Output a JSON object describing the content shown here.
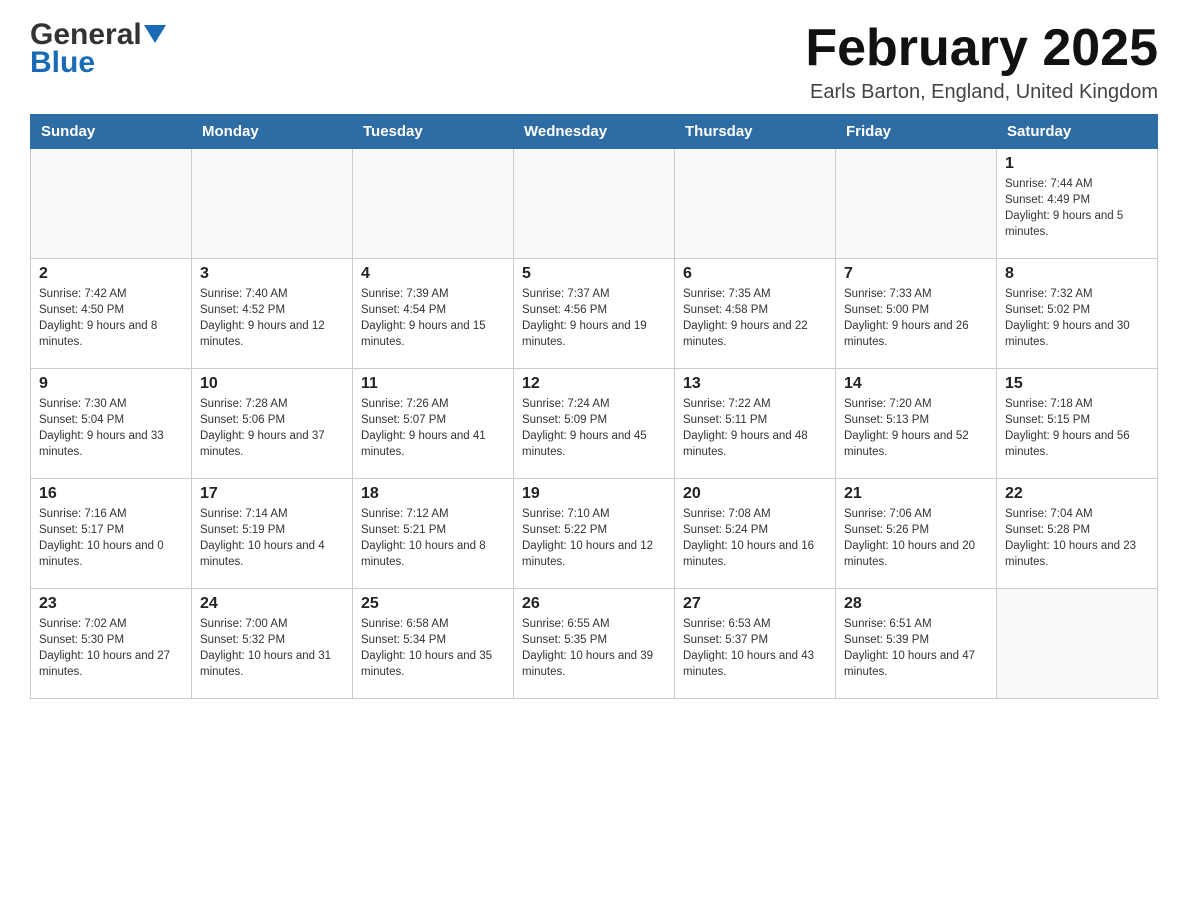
{
  "header": {
    "logo_general": "General",
    "logo_blue": "Blue",
    "month_title": "February 2025",
    "location": "Earls Barton, England, United Kingdom"
  },
  "weekdays": [
    "Sunday",
    "Monday",
    "Tuesday",
    "Wednesday",
    "Thursday",
    "Friday",
    "Saturday"
  ],
  "weeks": [
    [
      {
        "day": "",
        "info": ""
      },
      {
        "day": "",
        "info": ""
      },
      {
        "day": "",
        "info": ""
      },
      {
        "day": "",
        "info": ""
      },
      {
        "day": "",
        "info": ""
      },
      {
        "day": "",
        "info": ""
      },
      {
        "day": "1",
        "info": "Sunrise: 7:44 AM\nSunset: 4:49 PM\nDaylight: 9 hours and 5 minutes."
      }
    ],
    [
      {
        "day": "2",
        "info": "Sunrise: 7:42 AM\nSunset: 4:50 PM\nDaylight: 9 hours and 8 minutes."
      },
      {
        "day": "3",
        "info": "Sunrise: 7:40 AM\nSunset: 4:52 PM\nDaylight: 9 hours and 12 minutes."
      },
      {
        "day": "4",
        "info": "Sunrise: 7:39 AM\nSunset: 4:54 PM\nDaylight: 9 hours and 15 minutes."
      },
      {
        "day": "5",
        "info": "Sunrise: 7:37 AM\nSunset: 4:56 PM\nDaylight: 9 hours and 19 minutes."
      },
      {
        "day": "6",
        "info": "Sunrise: 7:35 AM\nSunset: 4:58 PM\nDaylight: 9 hours and 22 minutes."
      },
      {
        "day": "7",
        "info": "Sunrise: 7:33 AM\nSunset: 5:00 PM\nDaylight: 9 hours and 26 minutes."
      },
      {
        "day": "8",
        "info": "Sunrise: 7:32 AM\nSunset: 5:02 PM\nDaylight: 9 hours and 30 minutes."
      }
    ],
    [
      {
        "day": "9",
        "info": "Sunrise: 7:30 AM\nSunset: 5:04 PM\nDaylight: 9 hours and 33 minutes."
      },
      {
        "day": "10",
        "info": "Sunrise: 7:28 AM\nSunset: 5:06 PM\nDaylight: 9 hours and 37 minutes."
      },
      {
        "day": "11",
        "info": "Sunrise: 7:26 AM\nSunset: 5:07 PM\nDaylight: 9 hours and 41 minutes."
      },
      {
        "day": "12",
        "info": "Sunrise: 7:24 AM\nSunset: 5:09 PM\nDaylight: 9 hours and 45 minutes."
      },
      {
        "day": "13",
        "info": "Sunrise: 7:22 AM\nSunset: 5:11 PM\nDaylight: 9 hours and 48 minutes."
      },
      {
        "day": "14",
        "info": "Sunrise: 7:20 AM\nSunset: 5:13 PM\nDaylight: 9 hours and 52 minutes."
      },
      {
        "day": "15",
        "info": "Sunrise: 7:18 AM\nSunset: 5:15 PM\nDaylight: 9 hours and 56 minutes."
      }
    ],
    [
      {
        "day": "16",
        "info": "Sunrise: 7:16 AM\nSunset: 5:17 PM\nDaylight: 10 hours and 0 minutes."
      },
      {
        "day": "17",
        "info": "Sunrise: 7:14 AM\nSunset: 5:19 PM\nDaylight: 10 hours and 4 minutes."
      },
      {
        "day": "18",
        "info": "Sunrise: 7:12 AM\nSunset: 5:21 PM\nDaylight: 10 hours and 8 minutes."
      },
      {
        "day": "19",
        "info": "Sunrise: 7:10 AM\nSunset: 5:22 PM\nDaylight: 10 hours and 12 minutes."
      },
      {
        "day": "20",
        "info": "Sunrise: 7:08 AM\nSunset: 5:24 PM\nDaylight: 10 hours and 16 minutes."
      },
      {
        "day": "21",
        "info": "Sunrise: 7:06 AM\nSunset: 5:26 PM\nDaylight: 10 hours and 20 minutes."
      },
      {
        "day": "22",
        "info": "Sunrise: 7:04 AM\nSunset: 5:28 PM\nDaylight: 10 hours and 23 minutes."
      }
    ],
    [
      {
        "day": "23",
        "info": "Sunrise: 7:02 AM\nSunset: 5:30 PM\nDaylight: 10 hours and 27 minutes."
      },
      {
        "day": "24",
        "info": "Sunrise: 7:00 AM\nSunset: 5:32 PM\nDaylight: 10 hours and 31 minutes."
      },
      {
        "day": "25",
        "info": "Sunrise: 6:58 AM\nSunset: 5:34 PM\nDaylight: 10 hours and 35 minutes."
      },
      {
        "day": "26",
        "info": "Sunrise: 6:55 AM\nSunset: 5:35 PM\nDaylight: 10 hours and 39 minutes."
      },
      {
        "day": "27",
        "info": "Sunrise: 6:53 AM\nSunset: 5:37 PM\nDaylight: 10 hours and 43 minutes."
      },
      {
        "day": "28",
        "info": "Sunrise: 6:51 AM\nSunset: 5:39 PM\nDaylight: 10 hours and 47 minutes."
      },
      {
        "day": "",
        "info": ""
      }
    ]
  ]
}
